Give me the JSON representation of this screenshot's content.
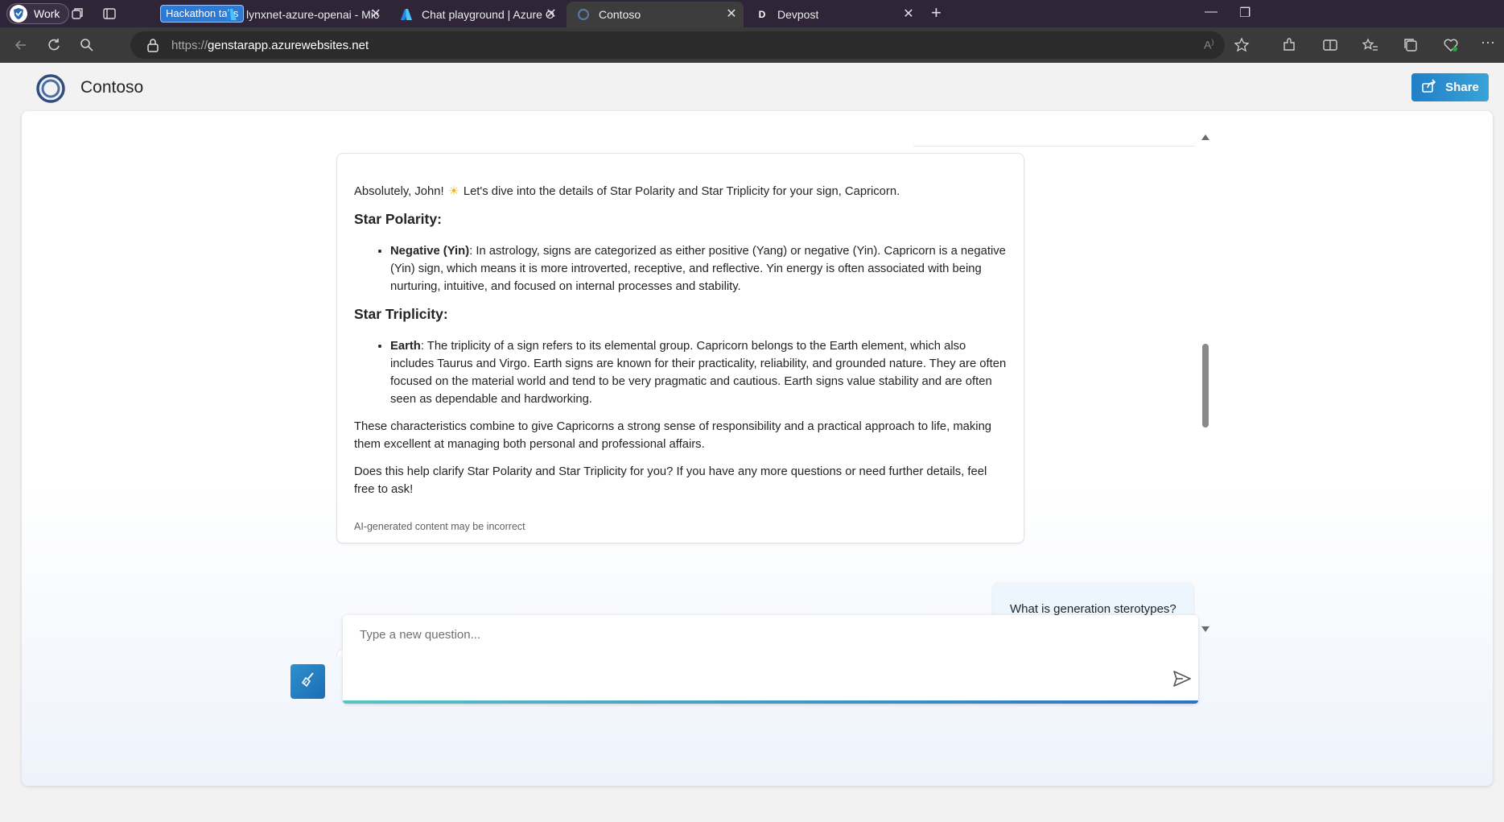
{
  "browser": {
    "profile": "Work",
    "tab_group": "Hackathon tabs",
    "tabs": [
      {
        "title": "lynxnet-azure-openai - Microsoft"
      },
      {
        "title": "Chat playground | Azure OpenAI"
      },
      {
        "title": "Contoso"
      },
      {
        "title": "Devpost"
      }
    ],
    "url_scheme": "https://",
    "url_host": "genstarapp.azurewebsites.net"
  },
  "app": {
    "title": "Contoso",
    "share_label": "Share"
  },
  "chat": {
    "answer": {
      "intro_a": "Absolutely, John!",
      "intro_b": "Let's dive into the details of Star Polarity and Star Triplicity for your sign, Capricorn.",
      "polarity_heading": "Star Polarity:",
      "polarity_term": "Negative (Yin)",
      "polarity_text": ": In astrology, signs are categorized as either positive (Yang) or negative (Yin). Capricorn is a negative (Yin) sign, which means it is more introverted, receptive, and reflective. Yin energy is often associated with being nurturing, intuitive, and focused on internal processes and stability.",
      "triplicity_heading": "Star Triplicity:",
      "triplicity_term": "Earth",
      "triplicity_text": ": The triplicity of a sign refers to its elemental group. Capricorn belongs to the Earth element, which also includes Taurus and Virgo. Earth signs are known for their practicality, reliability, and grounded nature. They are often focused on the material world and tend to be very pragmatic and cautious. Earth signs value stability and are often seen as dependable and hardworking.",
      "summary": "These characteristics combine to give Capricorns a strong sense of responsibility and a practical approach to life, making them excellent at managing both personal and professional affairs.",
      "followup": "Does this help clarify Star Polarity and Star Triplicity for you? If you have any more questions or need further details, feel free to ask!",
      "disclaimer": "AI-generated content may be incorrect"
    },
    "user_message": "What is generation sterotypes?"
  },
  "input": {
    "placeholder": "Type a new question..."
  },
  "icons": {
    "sparkle": "sun-emoji-icon",
    "clear": "broom-icon",
    "send": "send-icon"
  },
  "colors": {
    "accent": "#1f7fc7",
    "tab_bar": "#2f2438"
  }
}
